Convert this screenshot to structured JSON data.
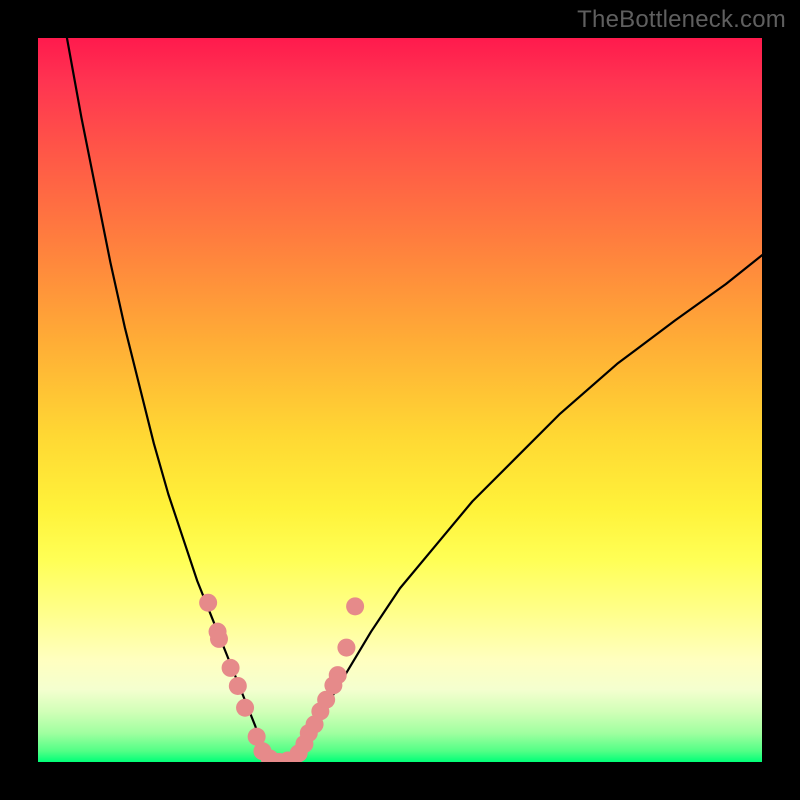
{
  "watermark": "TheBottleneck.com",
  "colors": {
    "background": "#000000",
    "curve_stroke": "#000000",
    "marker_fill": "#e68a8a",
    "marker_stroke": "#c07070"
  },
  "chart_data": {
    "type": "line",
    "title": "",
    "xlabel": "",
    "ylabel": "",
    "xlim": [
      0,
      100
    ],
    "ylim": [
      0,
      100
    ],
    "curve_description": "V-shaped bottleneck curve. Left branch descends steeply from ~100 at x≈4 to 0 at x≈31. Right branch rises with decreasing slope from 0 at x≈36 toward ~70 at x=100.",
    "series": [
      {
        "name": "bottleneck-curve",
        "x": [
          4,
          6,
          8,
          10,
          12,
          14,
          16,
          18,
          20,
          22,
          24,
          26,
          28,
          30,
          31,
          33,
          34,
          36,
          38,
          40,
          43,
          46,
          50,
          55,
          60,
          66,
          72,
          80,
          88,
          95,
          100
        ],
        "y": [
          100,
          89,
          79,
          69,
          60,
          52,
          44,
          37,
          31,
          25,
          20,
          15,
          10,
          5,
          2,
          0,
          0,
          1,
          4,
          8,
          13,
          18,
          24,
          30,
          36,
          42,
          48,
          55,
          61,
          66,
          70
        ]
      }
    ],
    "markers": {
      "name": "highlighted-points",
      "description": "Salmon dots clustered near the vertex of the V along both branches in the green band (y ≲ 22).",
      "x": [
        23.5,
        24.8,
        25.0,
        26.6,
        27.6,
        28.6,
        30.2,
        31.0,
        32.0,
        33.3,
        34.5,
        36.0,
        36.8,
        37.4,
        38.2,
        39.0,
        39.8,
        40.8,
        41.4,
        42.6,
        43.8
      ],
      "y": [
        22.0,
        18.0,
        17.0,
        13.0,
        10.5,
        7.5,
        3.5,
        1.5,
        0.5,
        0.0,
        0.2,
        1.2,
        2.5,
        4.0,
        5.2,
        7.0,
        8.6,
        10.6,
        12.0,
        15.8,
        21.5
      ]
    }
  }
}
